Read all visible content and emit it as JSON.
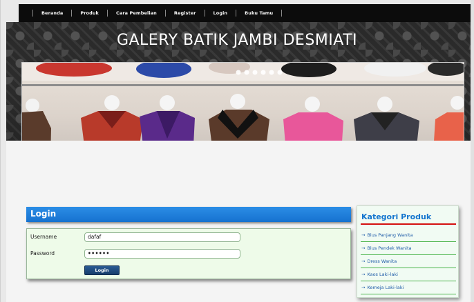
{
  "nav": {
    "items": [
      "Beranda",
      "Produk",
      "Cara Pembelian",
      "Register",
      "Login",
      "Buku Tamu"
    ]
  },
  "header": {
    "title": "GALERY BATIK JAMBI DESMIATI"
  },
  "banner": {
    "slide_indicators": 6
  },
  "login": {
    "title": "Login",
    "username_label": "Username",
    "username_value": "dafaf",
    "password_label": "Password",
    "password_value": "••••••",
    "button_label": "Login"
  },
  "categories": {
    "title": "Kategori Produk",
    "items": [
      "Blus Panjang Wanita",
      "Blus Pendek Wanita",
      "Dress Wanita",
      "Kaos Laki-laki",
      "Kemeja Laki-laki"
    ]
  },
  "colors": {
    "accent_blue": "#1672cf",
    "header_dark": "#2e2e2e",
    "category_underline": "#d40f0f",
    "category_divider": "#48b348"
  }
}
